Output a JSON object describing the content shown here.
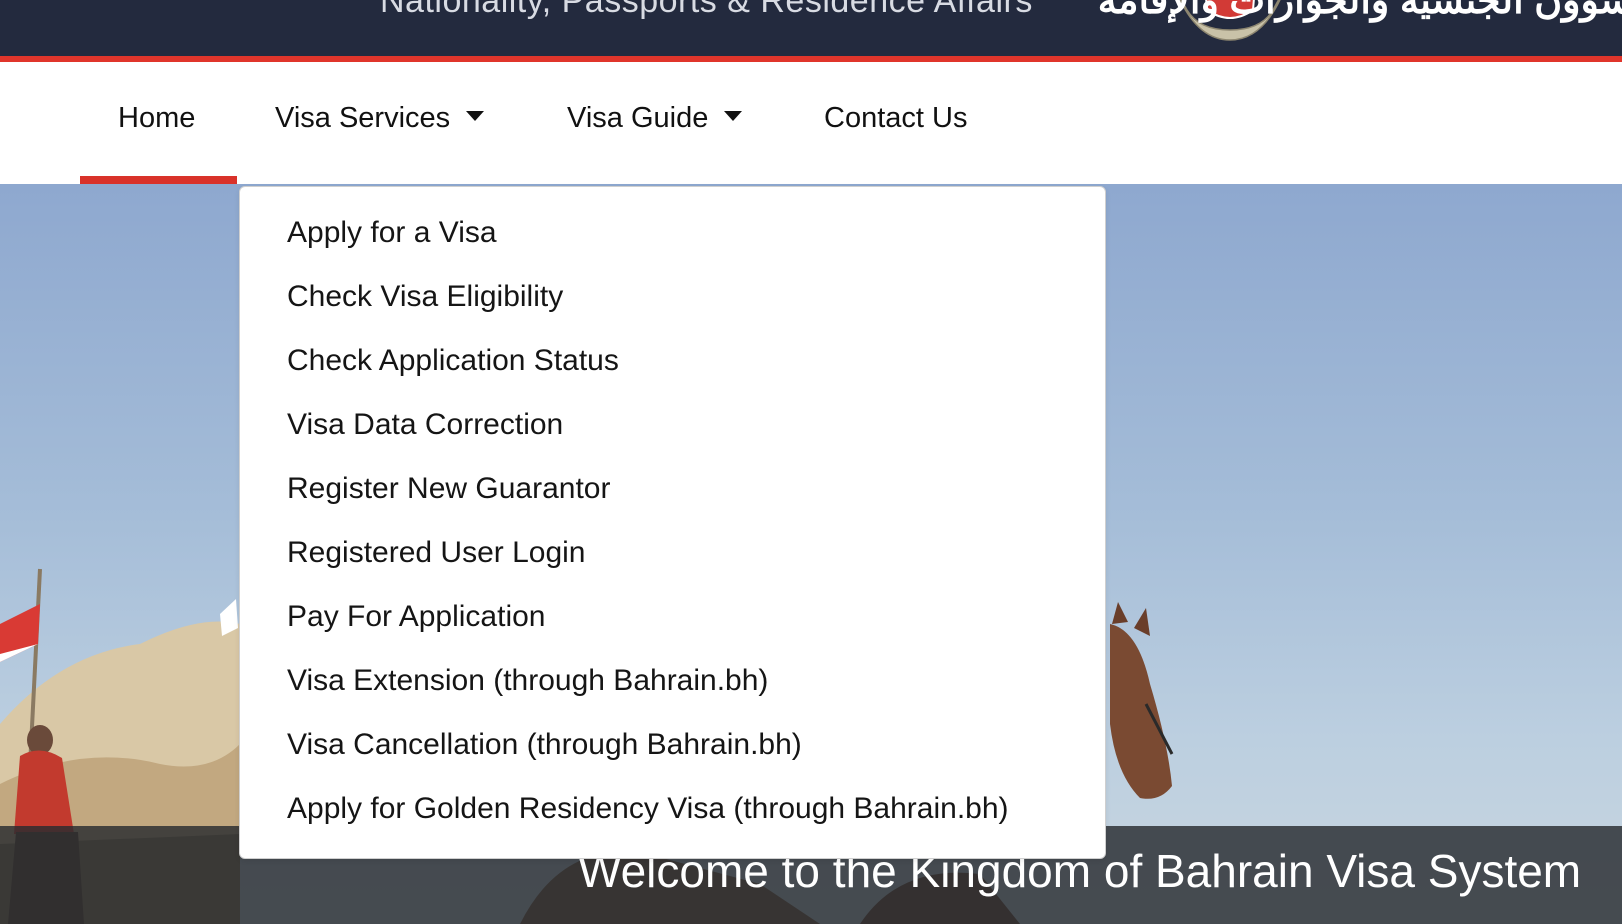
{
  "header": {
    "title_en": "Nationality, Passports & Residence Affairs",
    "title_ar": "شؤون الجنسية والجوازات والإقامة"
  },
  "nav": {
    "home": "Home",
    "visa_services": "Visa Services",
    "visa_guide": "Visa Guide",
    "contact_us": "Contact Us",
    "active": "Home"
  },
  "dropdown": {
    "items": [
      "Apply for a Visa",
      "Check Visa Eligibility",
      "Check Application Status",
      "Visa Data Correction",
      "Register New Guarantor",
      "Registered User Login",
      "Pay For Application",
      "Visa Extension (through Bahrain.bh)",
      "Visa Cancellation (through Bahrain.bh)",
      "Apply for Golden Residency Visa (through Bahrain.bh)"
    ]
  },
  "hero": {
    "welcome": "Welcome to the Kingdom of Bahrain Visa System"
  },
  "colors": {
    "header_bg": "#232a3e",
    "accent_red": "#e0352b",
    "welcome_band": "#282c30"
  }
}
